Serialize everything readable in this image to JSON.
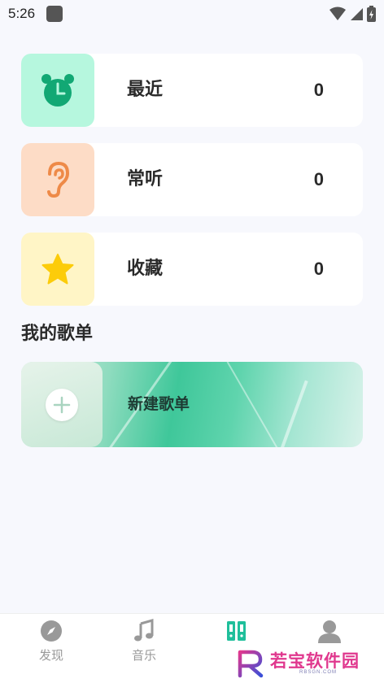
{
  "status_bar": {
    "time": "5:26"
  },
  "cards": [
    {
      "label": "最近",
      "count": "0",
      "icon": "alarm-clock-icon",
      "tile_color": "#b6f7de"
    },
    {
      "label": "常听",
      "count": "0",
      "icon": "ear-icon",
      "tile_color": "#fddcc6"
    },
    {
      "label": "收藏",
      "count": "0",
      "icon": "star-icon",
      "tile_color": "#fff5c6"
    }
  ],
  "section": {
    "title": "我的歌单"
  },
  "playlist": {
    "new_label": "新建歌单",
    "icon": "plus-icon"
  },
  "bottom_nav": [
    {
      "label": "发现",
      "icon": "compass-icon"
    },
    {
      "label": "音乐",
      "icon": "music-note-icon"
    },
    {
      "label": "",
      "icon": "library-icon",
      "active": true,
      "active_color": "#1fbf9b"
    },
    {
      "label": "",
      "icon": "user-icon"
    }
  ],
  "watermark": {
    "text": "若宝软件园",
    "sub": "RBSGN.COM"
  }
}
